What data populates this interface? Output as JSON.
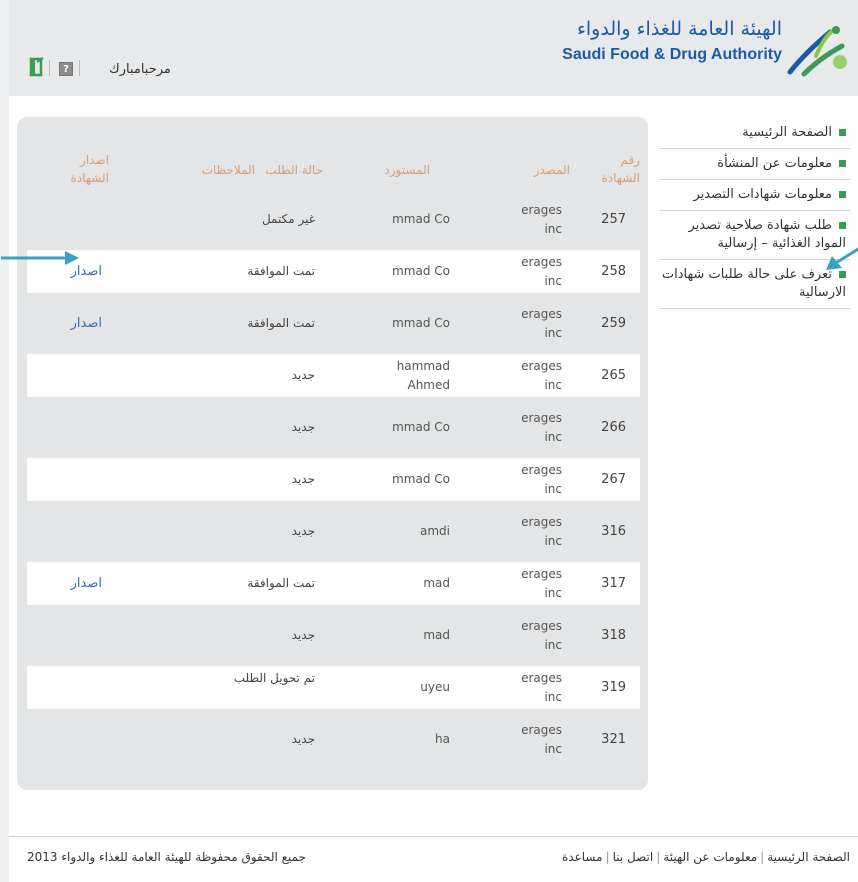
{
  "header": {
    "logo_ar": "الهيئة العامة للغذاء والدواء",
    "logo_en": "Saudi Food & Drug Authority",
    "welcome": "مرحبامبارك",
    "help_label": "?"
  },
  "sidebar": {
    "items": [
      {
        "label": "الصفحة الرئيسية"
      },
      {
        "label": "معلومات عن المنشأة"
      },
      {
        "label": "معلومات شهادات التصدير"
      },
      {
        "label": "طلب شهادة صلاحية تصدير المواد الغذائية – إرسالية"
      },
      {
        "label": "تعرف على حالة طلبات شهادات الارسالية"
      }
    ]
  },
  "table": {
    "headers": {
      "number": "رقم الشهادة",
      "source": "المصدر",
      "importer": "المستورد",
      "status": "حالة الطلب",
      "notes": "الملاحظات",
      "issue": "اصدار الشهادة"
    },
    "rows": [
      {
        "number": "257",
        "source": "erages inc",
        "importer": "mmad Co",
        "status": "غير مكتمل",
        "action": ""
      },
      {
        "number": "258",
        "source": "erages inc",
        "importer": "mmad Co",
        "status": "تمت الموافقة",
        "action": "اصدار"
      },
      {
        "number": "259",
        "source": "erages inc",
        "importer": "mmad Co",
        "status": "تمت الموافقة",
        "action": "اصدار"
      },
      {
        "number": "265",
        "source": "erages inc",
        "importer": "hammad Ahmed",
        "status": "جديد",
        "action": ""
      },
      {
        "number": "266",
        "source": "erages inc",
        "importer": "mmad Co",
        "status": "جديد",
        "action": ""
      },
      {
        "number": "267",
        "source": "erages inc",
        "importer": "mmad Co",
        "status": "جديد",
        "action": ""
      },
      {
        "number": "316",
        "source": "erages inc",
        "importer": "amdi",
        "status": "جديد",
        "action": ""
      },
      {
        "number": "317",
        "source": "erages inc",
        "importer": "mad",
        "status": "تمت الموافقة",
        "action": "اصدار"
      },
      {
        "number": "318",
        "source": "erages inc",
        "importer": "mad",
        "status": "جديد",
        "action": ""
      },
      {
        "number": "319",
        "source": "erages inc",
        "importer": "uyeu",
        "status": "تم تحويل الطلب",
        "action": ""
      },
      {
        "number": "321",
        "source": "erages inc",
        "importer": "ha",
        "status": "جديد",
        "action": ""
      }
    ]
  },
  "footer": {
    "links": [
      "الصفحة الرئيسية",
      "معلومات عن الهيئة",
      "اتصل بنا",
      "مساعدة"
    ],
    "separator": "|",
    "copyright": "جميع الحقوق محفوظة للهيئة العامة للغذاء والدواء 2013"
  },
  "colors": {
    "accent_green": "#3d9a56",
    "link_blue": "#3a6fb5",
    "header_tan": "#d3a077",
    "annotation_arrow": "#3aa0c8"
  }
}
